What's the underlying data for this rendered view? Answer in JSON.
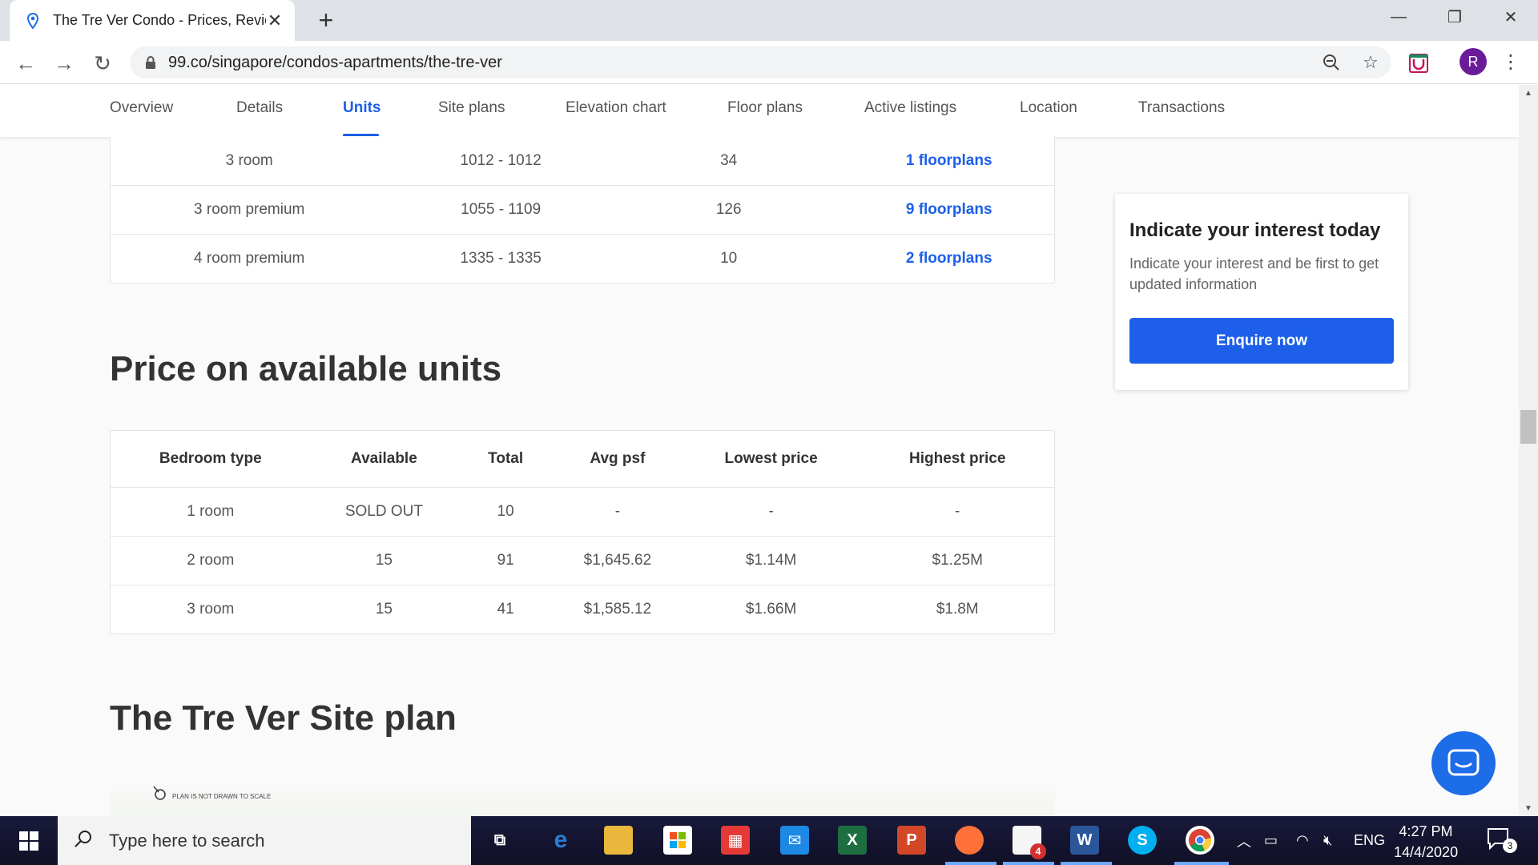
{
  "browser": {
    "tab_title": "The Tre Ver Condo - Prices, Revie",
    "url": "99.co/singapore/condos-apartments/the-tre-ver",
    "profile_initial": "R"
  },
  "subnav": {
    "items": [
      "Overview",
      "Details",
      "Units",
      "Site plans",
      "Elevation chart",
      "Floor plans",
      "Active listings",
      "Location",
      "Transactions"
    ],
    "active": "Units"
  },
  "units_table": {
    "rows": [
      {
        "type": "3 room",
        "size": "1012 - 1012",
        "count": "34",
        "floorplans": "1 floorplans"
      },
      {
        "type": "3 room premium",
        "size": "1055 - 1109",
        "count": "126",
        "floorplans": "9 floorplans"
      },
      {
        "type": "4 room premium",
        "size": "1335 - 1335",
        "count": "10",
        "floorplans": "2 floorplans"
      }
    ]
  },
  "price_section": {
    "heading": "Price on available units",
    "headers": [
      "Bedroom type",
      "Available",
      "Total",
      "Avg psf",
      "Lowest price",
      "Highest price"
    ],
    "rows": [
      [
        "1 room",
        "SOLD OUT",
        "10",
        "-",
        "-",
        "-"
      ],
      [
        "2 room",
        "15",
        "91",
        "$1,645.62",
        "$1.14M",
        "$1.25M"
      ],
      [
        "3 room",
        "15",
        "41",
        "$1,585.12",
        "$1.66M",
        "$1.8M"
      ]
    ]
  },
  "siteplan": {
    "heading": "The Tre Ver Site plan",
    "note": "PLAN IS NOT DRAWN TO SCALE"
  },
  "interest_card": {
    "title": "Indicate your interest today",
    "description": "Indicate your interest and be first to get updated information",
    "button": "Enquire now"
  },
  "taskbar": {
    "search_placeholder": "Type here to search",
    "language": "ENG",
    "time": "4:27 PM",
    "date": "14/4/2020",
    "file_badge": "4",
    "notification_count": "3"
  },
  "colors": {
    "accent": "#1d5fe8"
  }
}
